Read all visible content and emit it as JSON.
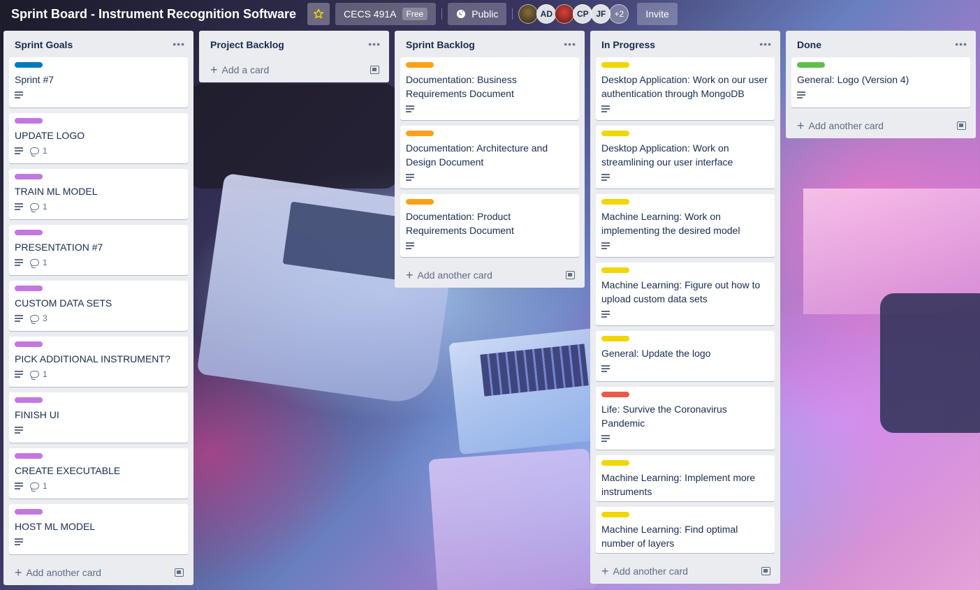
{
  "header": {
    "board_title": "Sprint Board - Instrument Recognition Software",
    "workspace": "CECS 491A",
    "workspace_badge": "Free",
    "visibility": "Public",
    "avatars": [
      "AD",
      "CP",
      "JF"
    ],
    "more_members": "+2",
    "invite_label": "Invite"
  },
  "labels": {
    "blue": "#0079bf",
    "purple": "#c377e0",
    "orange": "#ff9f1a",
    "yellow": "#f2d600",
    "green": "#61bd4f",
    "red": "#eb5a46"
  },
  "lists": {
    "sprint_goals": {
      "title": "Sprint Goals",
      "add_label": "Add another card",
      "cards": [
        {
          "title": "Sprint #7",
          "label": "blue"
        },
        {
          "title": "UPDATE LOGO",
          "label": "purple",
          "comments": "1"
        },
        {
          "title": "TRAIN ML MODEL",
          "label": "purple",
          "comments": "1"
        },
        {
          "title": "PRESENTATION #7",
          "label": "purple",
          "comments": "1"
        },
        {
          "title": "CUSTOM DATA SETS",
          "label": "purple",
          "comments": "3"
        },
        {
          "title": "PICK ADDITIONAL INSTRUMENT?",
          "label": "purple",
          "comments": "1"
        },
        {
          "title": "FINISH UI",
          "label": "purple"
        },
        {
          "title": "CREATE EXECUTABLE",
          "label": "purple",
          "comments": "1"
        },
        {
          "title": "HOST ML MODEL",
          "label": "purple"
        }
      ]
    },
    "project_backlog": {
      "title": "Project Backlog",
      "add_label": "Add a card"
    },
    "sprint_backlog": {
      "title": "Sprint Backlog",
      "add_label": "Add another card",
      "cards": [
        {
          "title": "Documentation: Business Requirements Document",
          "label": "orange"
        },
        {
          "title": "Documentation: Architecture and Design Document",
          "label": "orange"
        },
        {
          "title": "Documentation: Product Requirements Document",
          "label": "orange"
        }
      ]
    },
    "in_progress": {
      "title": "In Progress",
      "add_label": "Add another card",
      "cards": [
        {
          "title": "Desktop Application: Work on our user authentication through MongoDB",
          "label": "yellow"
        },
        {
          "title": "Desktop Application: Work on streamlining our user interface",
          "label": "yellow"
        },
        {
          "title": "Machine Learning: Work on implementing the desired model",
          "label": "yellow"
        },
        {
          "title": "Machine Learning: Figure out how to upload custom data sets",
          "label": "yellow"
        },
        {
          "title": "General: Update the logo",
          "label": "yellow"
        },
        {
          "title": "Life: Survive the Coronavirus Pandemic",
          "label": "red"
        },
        {
          "title": "Machine Learning: Implement more instruments",
          "label": "yellow"
        },
        {
          "title": "Machine Learning: Find optimal number of layers",
          "label": "yellow"
        }
      ]
    },
    "done": {
      "title": "Done",
      "add_label": "Add another card",
      "cards": [
        {
          "title": "General: Logo (Version 4)",
          "label": "green"
        }
      ]
    }
  }
}
